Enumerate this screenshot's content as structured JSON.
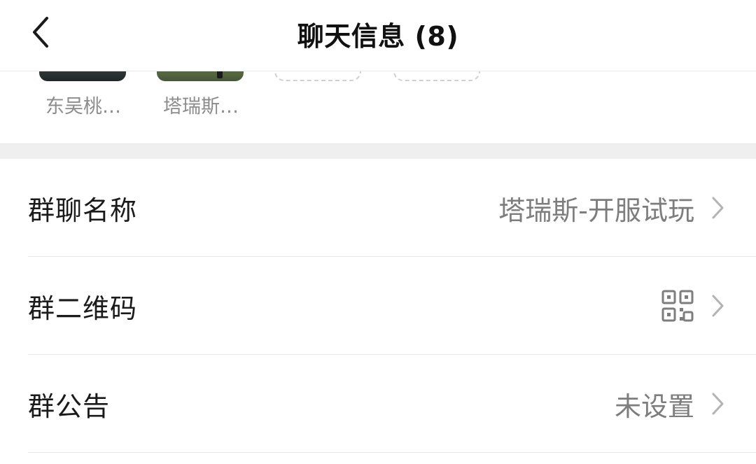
{
  "header": {
    "title": "聊天信息 (8)",
    "back_icon": "chevron-left-icon"
  },
  "members": [
    {
      "name": "东吴桃…"
    },
    {
      "name": "塔瑞斯…"
    }
  ],
  "settings": {
    "group_name": {
      "label": "群聊名称",
      "value": "塔瑞斯-开服试玩"
    },
    "group_qr": {
      "label": "群二维码",
      "icon": "qr-code-icon"
    },
    "group_notice": {
      "label": "群公告",
      "value": "未设置"
    }
  },
  "colors": {
    "primary_text": "#1a1a1a",
    "secondary_text": "#7d7d7d",
    "separator": "#efefef"
  }
}
